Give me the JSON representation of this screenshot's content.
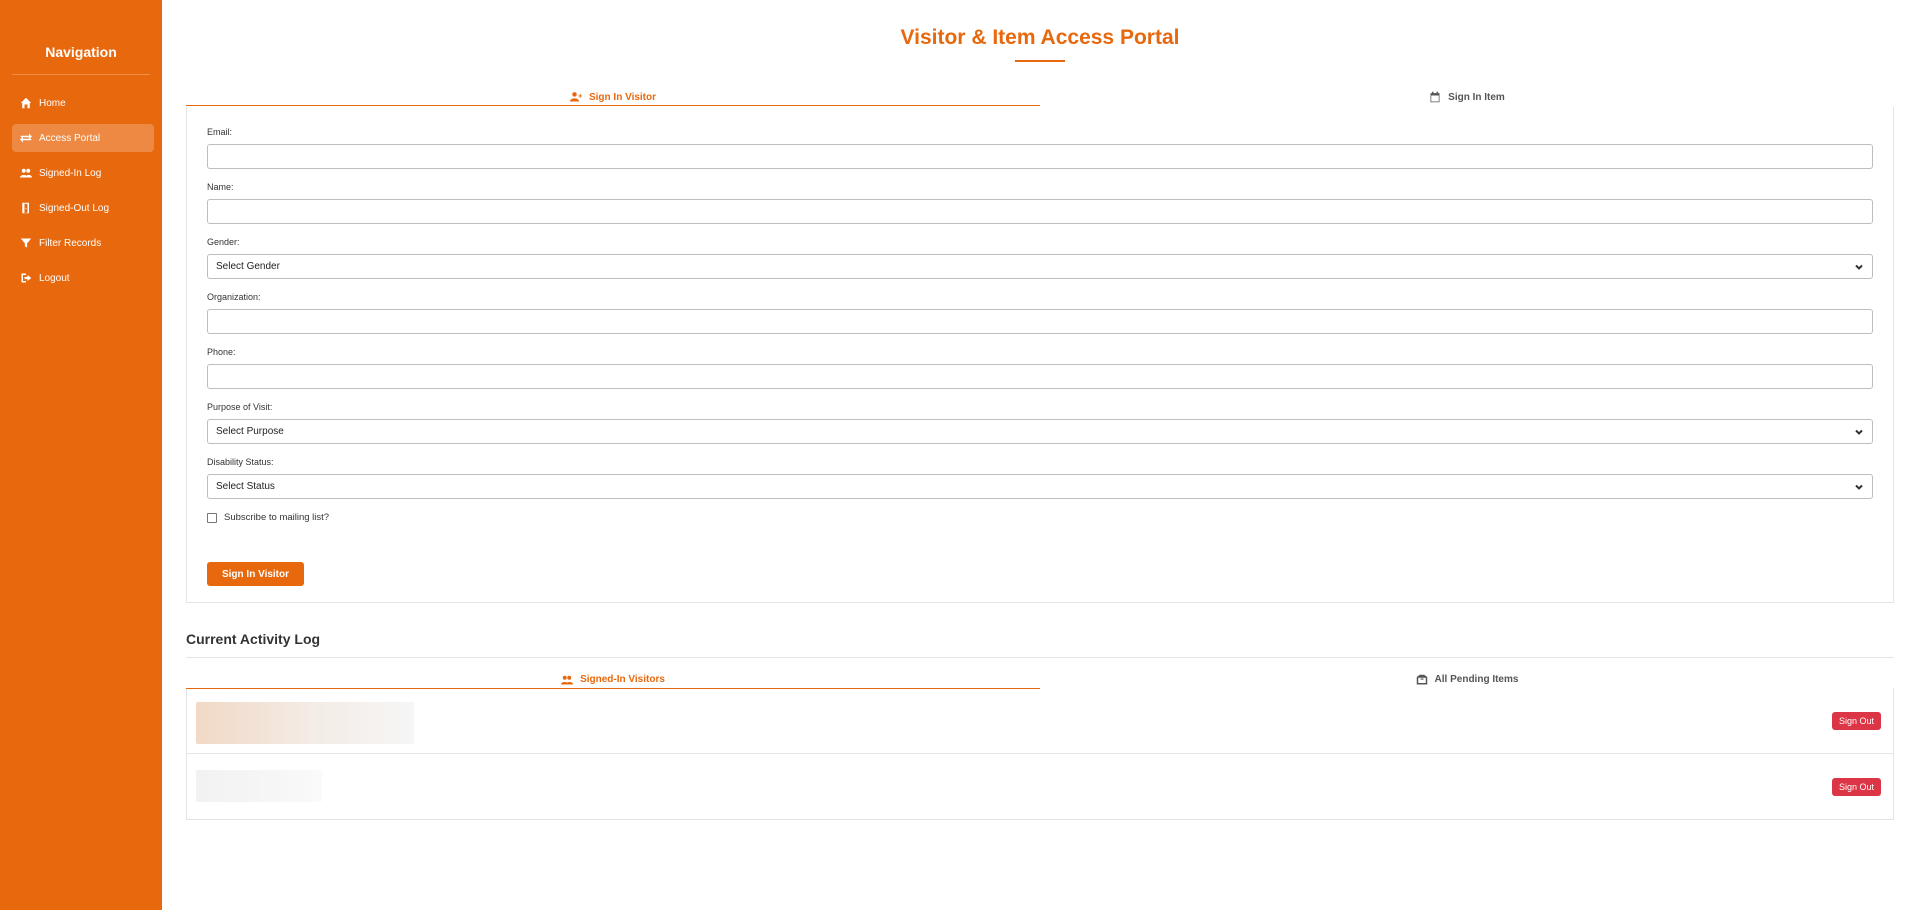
{
  "sidebar": {
    "title": "Navigation",
    "items": [
      {
        "label": "Home",
        "icon": "home-icon"
      },
      {
        "label": "Access Portal",
        "icon": "exchange-icon",
        "active": true
      },
      {
        "label": "Signed-In Log",
        "icon": "users-icon"
      },
      {
        "label": "Signed-Out Log",
        "icon": "door-open-icon"
      },
      {
        "label": "Filter Records",
        "icon": "filter-icon"
      },
      {
        "label": "Logout",
        "icon": "sign-out-icon"
      }
    ]
  },
  "header": {
    "title": "Visitor & Item Access Portal"
  },
  "form_tabs": [
    {
      "label": "Sign In Visitor",
      "icon": "user-plus-icon",
      "active": true
    },
    {
      "label": "Sign In Item",
      "icon": "calendar-icon",
      "active": false
    }
  ],
  "form": {
    "email_label": "Email:",
    "name_label": "Name:",
    "gender_label": "Gender:",
    "gender_value": "Select Gender",
    "organization_label": "Organization:",
    "phone_label": "Phone:",
    "purpose_label": "Purpose of Visit:",
    "purpose_value": "Select Purpose",
    "disability_label": "Disability Status:",
    "disability_value": "Select Status",
    "subscribe_label": "Subscribe to mailing list?",
    "submit_label": "Sign In Visitor"
  },
  "activity": {
    "title": "Current Activity Log",
    "tabs": [
      {
        "label": "Signed-In Visitors",
        "icon": "users-icon",
        "active": true
      },
      {
        "label": "All Pending Items",
        "icon": "boxes-icon",
        "active": false
      }
    ],
    "rows": [
      {
        "sign_out_label": "Sign Out"
      },
      {
        "sign_out_label": "Sign Out"
      }
    ]
  },
  "colors": {
    "accent": "#e8680d",
    "danger": "#dc3545"
  }
}
